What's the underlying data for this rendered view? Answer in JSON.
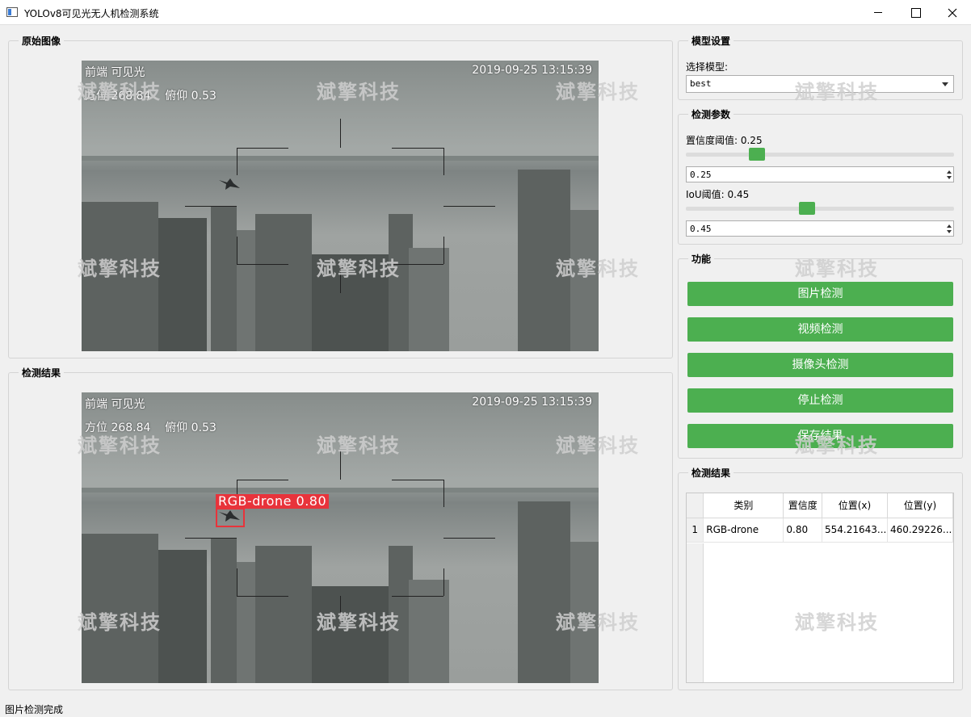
{
  "window": {
    "title": "YOLOv8可见光无人机检测系统"
  },
  "original_panel": {
    "title": "原始图像"
  },
  "result_panel": {
    "title": "检测结果"
  },
  "frame": {
    "top_left": "前端  可见光",
    "second_line": "方位 268.84    俯仰 0.53",
    "timestamp": "2019-09-25 13:15:39"
  },
  "detection": {
    "label": "RGB-drone 0.80"
  },
  "watermark": "斌擎科技",
  "model_settings": {
    "title": "模型设置",
    "select_label": "选择模型:",
    "selected_model": "best"
  },
  "params": {
    "title": "检测参数",
    "conf_label": "置信度阈值: 0.25",
    "conf_value": "0.25",
    "conf_fraction": 0.25,
    "iou_label": "IoU阈值: 0.45",
    "iou_value": "0.45",
    "iou_fraction": 0.45
  },
  "functions": {
    "title": "功能",
    "buttons": [
      "图片检测",
      "视频检测",
      "摄像头检测",
      "停止检测",
      "保存结果"
    ]
  },
  "results": {
    "title": "检测结果",
    "columns": [
      "类别",
      "置信度",
      "位置(x)",
      "位置(y)"
    ],
    "rows": [
      {
        "index": "1",
        "cls": "RGB-drone",
        "conf": "0.80",
        "x": "554.21643...",
        "y": "460.29226..."
      }
    ]
  },
  "status": {
    "text": "图片检测完成"
  }
}
